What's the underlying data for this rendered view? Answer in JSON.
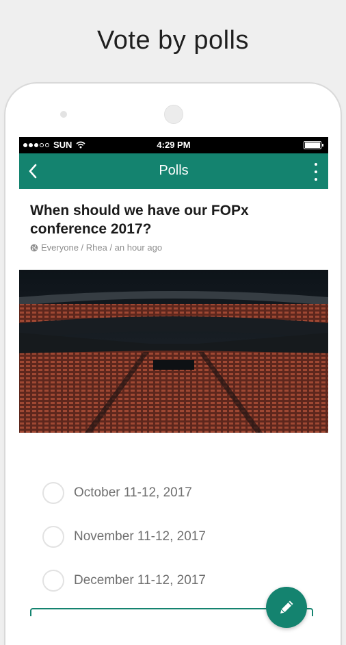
{
  "headline": "Vote by polls",
  "status_bar": {
    "carrier": "SUN",
    "time": "4:29 PM"
  },
  "app_bar": {
    "title": "Polls",
    "back_icon": "chevron-left-icon",
    "more_icon": "more-vertical-icon"
  },
  "poll": {
    "question": "When should we have our FOPx conference 2017?",
    "meta": "Everyone / Rhea / an hour ago",
    "options": [
      "October 11-12, 2017",
      "November 11-12, 2017",
      "December 11-12, 2017"
    ]
  },
  "fab_icon": "edit-pencil-icon",
  "colors": {
    "accent": "#14836f",
    "background": "#efefef"
  }
}
